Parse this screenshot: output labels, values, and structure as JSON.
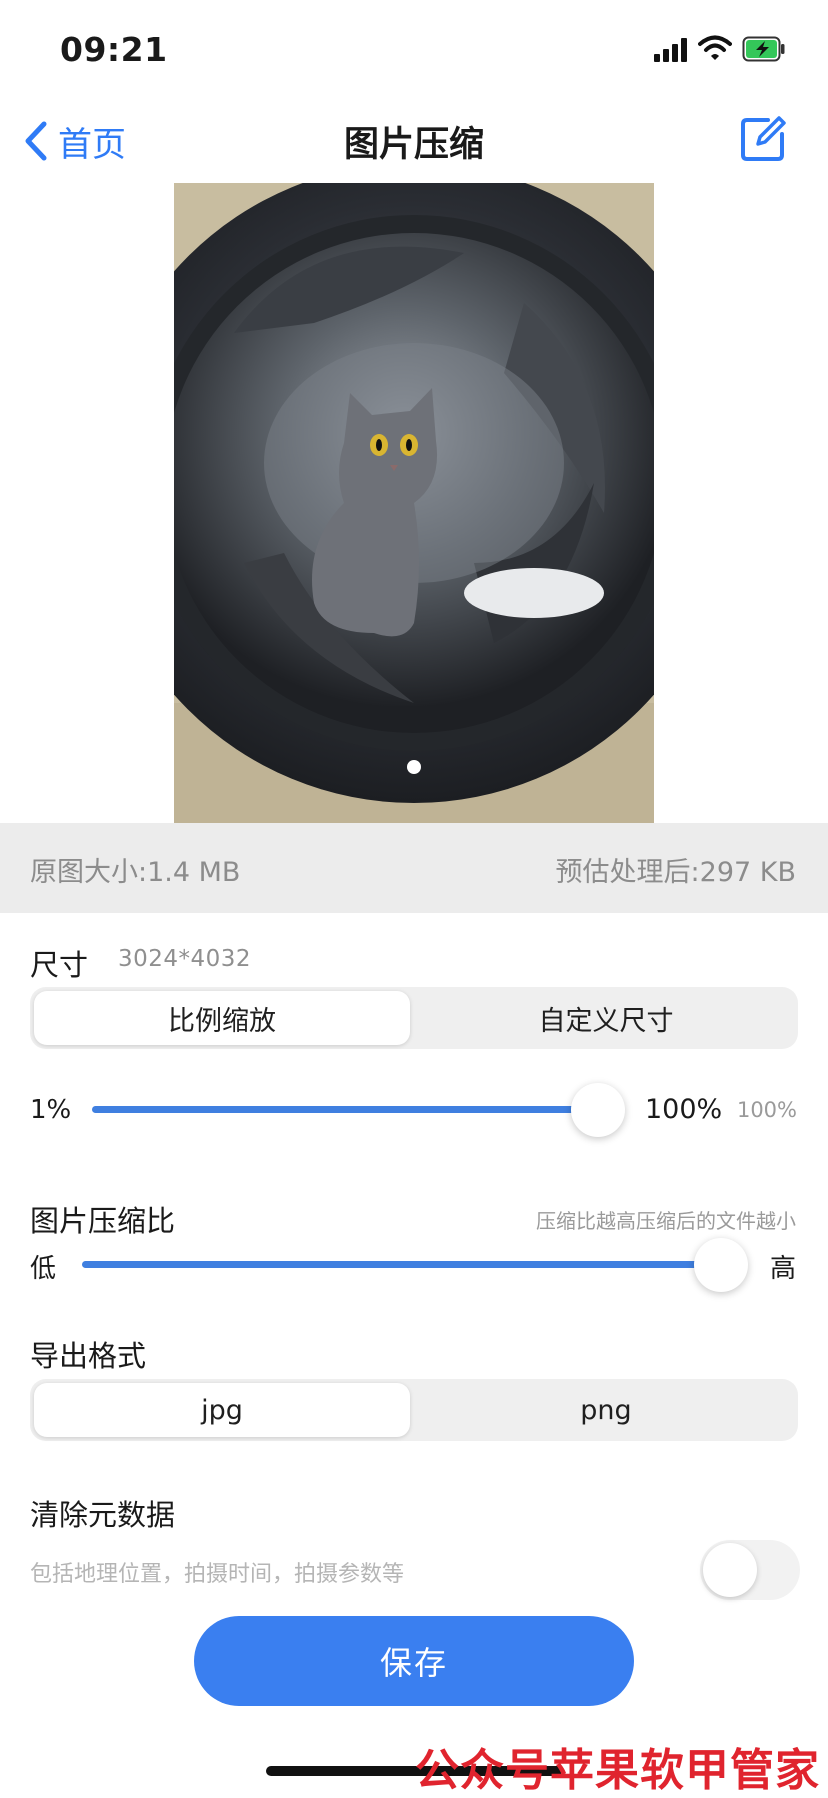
{
  "status_bar": {
    "time": "09:21"
  },
  "nav": {
    "back_label": "首页",
    "title": "图片压缩"
  },
  "size_info": {
    "original": "原图大小:1.4 MB",
    "estimated": "预估处理后:297 KB"
  },
  "dimensions": {
    "label": "尺寸",
    "value": "3024*4032",
    "modes": [
      {
        "label": "比例缩放",
        "selected": true
      },
      {
        "label": "自定义尺寸",
        "selected": false
      }
    ]
  },
  "scale_slider": {
    "min_label": "1%",
    "max_label": "100%",
    "current_label": "100%",
    "value_percent": 100
  },
  "compression": {
    "label": "图片压缩比",
    "hint": "压缩比越高压缩后的文件越小",
    "low_label": "低",
    "high_label": "高",
    "value_fraction": 1.0
  },
  "export_format": {
    "label": "导出格式",
    "options": [
      {
        "label": "jpg",
        "selected": true
      },
      {
        "label": "png",
        "selected": false
      }
    ]
  },
  "metadata": {
    "label": "清除元数据",
    "hint": "包括地理位置，拍摄时间，拍摄参数等",
    "enabled": false
  },
  "save_button": {
    "label": "保存"
  },
  "watermark": {
    "text": "公众号苹果软甲管家"
  },
  "colors": {
    "accent": "#3a7ff0",
    "back_link": "#2f7bf6",
    "watermark": "#e0242e"
  },
  "icons": {
    "back": "chevron-left-icon",
    "edit": "edit-icon"
  }
}
